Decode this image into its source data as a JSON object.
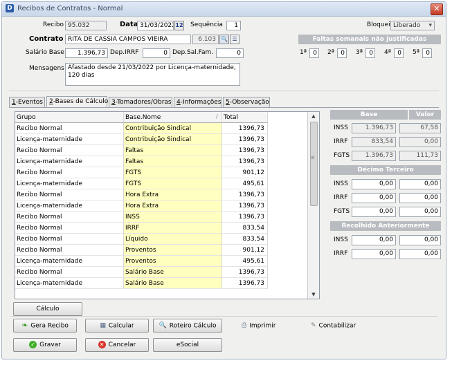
{
  "window": {
    "title": "Recibos de Contratos - Normal"
  },
  "header": {
    "recibo_label": "Recibo",
    "recibo_value": "95.032",
    "data_label": "Data",
    "data_value": "31/03/2022",
    "sequencia_label": "Sequência",
    "sequencia_value": "1",
    "bloqueio_label": "Bloqueio",
    "bloqueio_value": "Liberado",
    "contrato_label": "Contrato",
    "contrato_name": "RITA DE CASSIA CAMPOS VIEIRA",
    "contrato_code": "6.103",
    "salario_label": "Salário Base",
    "salario_value": "1.396,73",
    "dep_irrf_label": "Dep.IRRF",
    "dep_irrf_value": "0",
    "dep_salfam_label": "Dep.Sal.Fam.",
    "dep_salfam_value": "0",
    "mensagens_label": "Mensagens",
    "mensagens_value": "Afastado desde 21/03/2022 por Licença-maternidade, 120 dias"
  },
  "faltas": {
    "title": "Faltas semanais não justificadas",
    "weeks": [
      {
        "label": "1ª",
        "value": "0"
      },
      {
        "label": "2ª",
        "value": "0"
      },
      {
        "label": "3ª",
        "value": "0"
      },
      {
        "label": "4ª",
        "value": "0"
      },
      {
        "label": "5ª",
        "value": "0"
      }
    ]
  },
  "tabs": [
    {
      "key": "1",
      "label": "-Eventos"
    },
    {
      "key": "2",
      "label": "-Bases de Cálculo"
    },
    {
      "key": "3",
      "label": "-Tomadores/Obras"
    },
    {
      "key": "4",
      "label": "-Informações"
    },
    {
      "key": "5",
      "label": "-Observação"
    }
  ],
  "grid": {
    "columns": [
      "Grupo",
      "Base.Nome",
      "Total"
    ],
    "rows": [
      [
        "Recibo Normal",
        "Contribuição Sindical",
        "1396,73"
      ],
      [
        "Licença-maternidade",
        "Contribuição Sindical",
        "1396,73"
      ],
      [
        "Recibo Normal",
        "Faltas",
        "1396,73"
      ],
      [
        "Licença-maternidade",
        "Faltas",
        "1396,73"
      ],
      [
        "Recibo Normal",
        "FGTS",
        "901,12"
      ],
      [
        "Licença-maternidade",
        "FGTS",
        "495,61"
      ],
      [
        "Recibo Normal",
        "Hora Extra",
        "1396,73"
      ],
      [
        "Licença-maternidade",
        "Hora Extra",
        "1396,73"
      ],
      [
        "Recibo Normal",
        "INSS",
        "1396,73"
      ],
      [
        "Recibo Normal",
        "IRRF",
        "833,54"
      ],
      [
        "Recibo Normal",
        "Líquido",
        "833,54"
      ],
      [
        "Recibo Normal",
        "Proventos",
        "901,12"
      ],
      [
        "Licença-maternidade",
        "Proventos",
        "495,61"
      ],
      [
        "Recibo Normal",
        "Salário Base",
        "1396,73"
      ],
      [
        "Licença-maternidade",
        "Salário Base",
        "1396,73"
      ]
    ]
  },
  "side": {
    "base_header": "Base",
    "valor_header": "Valor",
    "main": [
      {
        "label": "INSS",
        "base": "1.396,73",
        "valor": "67,58"
      },
      {
        "label": "IRRF",
        "base": "833,54",
        "valor": "0,00"
      },
      {
        "label": "FGTS",
        "base": "1.396,73",
        "valor": "111,73"
      }
    ],
    "decimo_header": "Décimo Terceiro",
    "decimo": [
      {
        "label": "INSS",
        "base": "0,00",
        "valor": "0,00"
      },
      {
        "label": "IRRF",
        "base": "0,00",
        "valor": "0,00"
      },
      {
        "label": "FGTS",
        "base": "0,00",
        "valor": "0,00"
      }
    ],
    "recolhido_header": "Recolhido Anteriormente",
    "recolhido": [
      {
        "label": "INSS",
        "base": "0,00",
        "valor": "0,00"
      },
      {
        "label": "IRRF",
        "base": "0,00",
        "valor": "0,00"
      }
    ]
  },
  "buttons": {
    "calculo": "Cálculo",
    "gera_recibo": "Gera Recibo",
    "calcular": "Calcular",
    "roteiro": "Roteiro Cálculo",
    "imprimir": "Imprimir",
    "contabilizar": "Contabilizar",
    "gravar": "Gravar",
    "cancelar": "Cancelar",
    "esocial": "eSocial"
  }
}
